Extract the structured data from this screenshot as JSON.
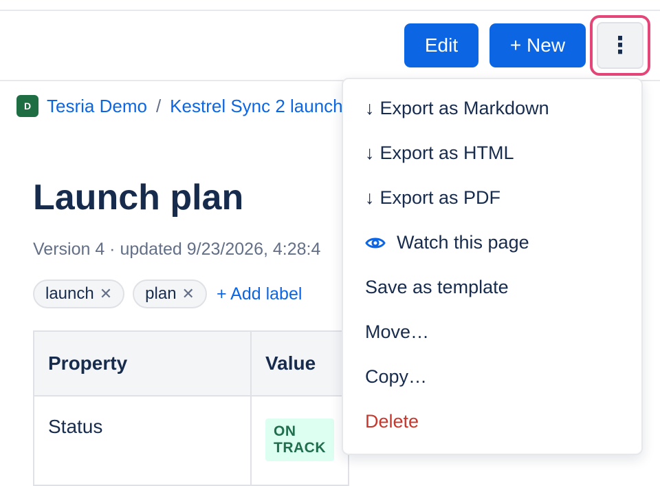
{
  "header": {
    "edit_label": "Edit",
    "new_label": "+ New",
    "more_label": "⋮"
  },
  "breadcrumb": {
    "space_initial": "D",
    "space_name": "Tesria Demo",
    "separator": "/",
    "page_name": "Kestrel Sync 2 launch"
  },
  "page": {
    "title": "Launch plan",
    "meta": "Version 4 · updated 9/23/2026, 4:28:4"
  },
  "labels": {
    "items": [
      "launch",
      "plan"
    ],
    "remove_glyph": "✕",
    "add_label": "+ Add label"
  },
  "table": {
    "headers": [
      "Property",
      "Value"
    ],
    "rows": [
      {
        "property": "Status",
        "value": "ON TRACK"
      }
    ]
  },
  "menu": {
    "items": [
      {
        "glyph": "↓",
        "label": "Export as Markdown"
      },
      {
        "glyph": "↓",
        "label": "Export as HTML"
      },
      {
        "glyph": "↓",
        "label": "Export as PDF"
      },
      {
        "icon": "eye-icon",
        "label": "Watch this page"
      },
      {
        "label": "Save as template"
      },
      {
        "label": "Move…"
      },
      {
        "label": "Copy…"
      },
      {
        "label": "Delete"
      }
    ]
  },
  "colors": {
    "primary": "#0c66e4",
    "focus_ring": "#e5467a",
    "danger": "#c9372c",
    "space_icon": "#1f6e43",
    "status_bg": "#dcfff1",
    "status_text": "#216e4e"
  }
}
